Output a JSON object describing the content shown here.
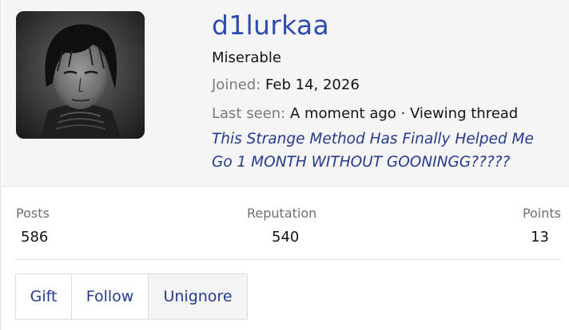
{
  "profile": {
    "username": "d1lurkaa",
    "user_title": "Miserable",
    "joined_label": "Joined:",
    "joined_value": "Feb 14, 2026",
    "last_seen_label": "Last seen:",
    "last_seen_value": "A moment ago · Viewing thread",
    "thread_title": "This Strange Method Has Finally Helped Me Go 1 MONTH WITHOUT GOONINGG?????"
  },
  "stats": {
    "posts_label": "Posts",
    "posts_value": "586",
    "reputation_label": "Reputation",
    "reputation_value": "540",
    "points_label": "Points",
    "points_value": "13"
  },
  "actions": {
    "gift_label": "Gift",
    "follow_label": "Follow",
    "unignore_label": "Unignore"
  },
  "colors": {
    "username": "#2e4bb1",
    "link": "#253a8f",
    "header_bg": "#f5f5f5"
  },
  "icons": {
    "avatar": "avatar-image"
  }
}
